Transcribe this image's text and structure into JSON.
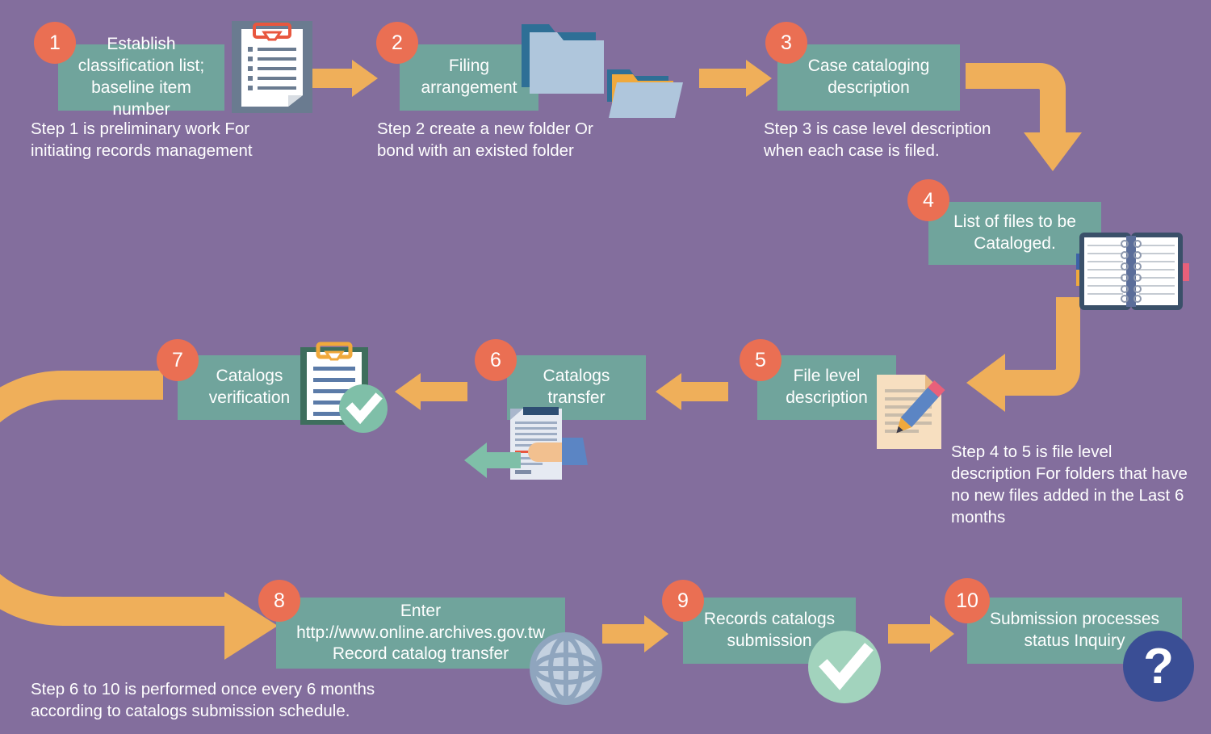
{
  "diagram": {
    "title": "Records management catalog submission workflow",
    "colors": {
      "background": "#836E9D",
      "node": "#70A49C",
      "badge": "#EA6F53",
      "arrow": "#EFAF5A",
      "check": "#7FBFA8",
      "question": "#3A4E95",
      "text": "#FFFFFF"
    },
    "steps": [
      {
        "number": "1",
        "label": "Establish\nclassification list;\nbaseline item number"
      },
      {
        "number": "2",
        "label": "Filing\narrangement"
      },
      {
        "number": "3",
        "label": "Case cataloging\ndescription"
      },
      {
        "number": "4",
        "label": "List of files to be\nCataloged."
      },
      {
        "number": "5",
        "label": "File level\ndescription"
      },
      {
        "number": "6",
        "label": "Catalogs transfer"
      },
      {
        "number": "7",
        "label": "Catalogs\nverification"
      },
      {
        "number": "8",
        "label": "Enter\nhttp://www.online.archives.gov.tw\nRecord catalog transfer"
      },
      {
        "number": "9",
        "label": "Records catalogs\nsubmission"
      },
      {
        "number": "10",
        "label": "Submission processes\nstatus Inquiry"
      }
    ],
    "captions": [
      {
        "id": "caption-step1",
        "text": "Step 1 is preliminary work For\ninitiating records management"
      },
      {
        "id": "caption-step2",
        "text": "Step 2 create a new folder Or\nbond with an existed folder"
      },
      {
        "id": "caption-step3",
        "text": "Step 3 is case level description\nwhen each case is filed."
      },
      {
        "id": "caption-step4-5",
        "text": "Step 4 to 5 is file level\ndescription For folders that have\nno new files added in the Last 6\nmonths"
      },
      {
        "id": "caption-step6-10",
        "text": "Step 6 to 10 is performed once every 6 months\naccording to catalogs submission schedule."
      }
    ],
    "icons": [
      "checklist-clipboard-icon",
      "blue-folder-icon",
      "open-folder-stack-icon",
      "spiral-notebook-icon",
      "document-pencil-icon",
      "hand-document-transfer-icon",
      "clipboard-check-icon",
      "globe-icon",
      "check-circle-icon",
      "question-mark-icon"
    ]
  }
}
